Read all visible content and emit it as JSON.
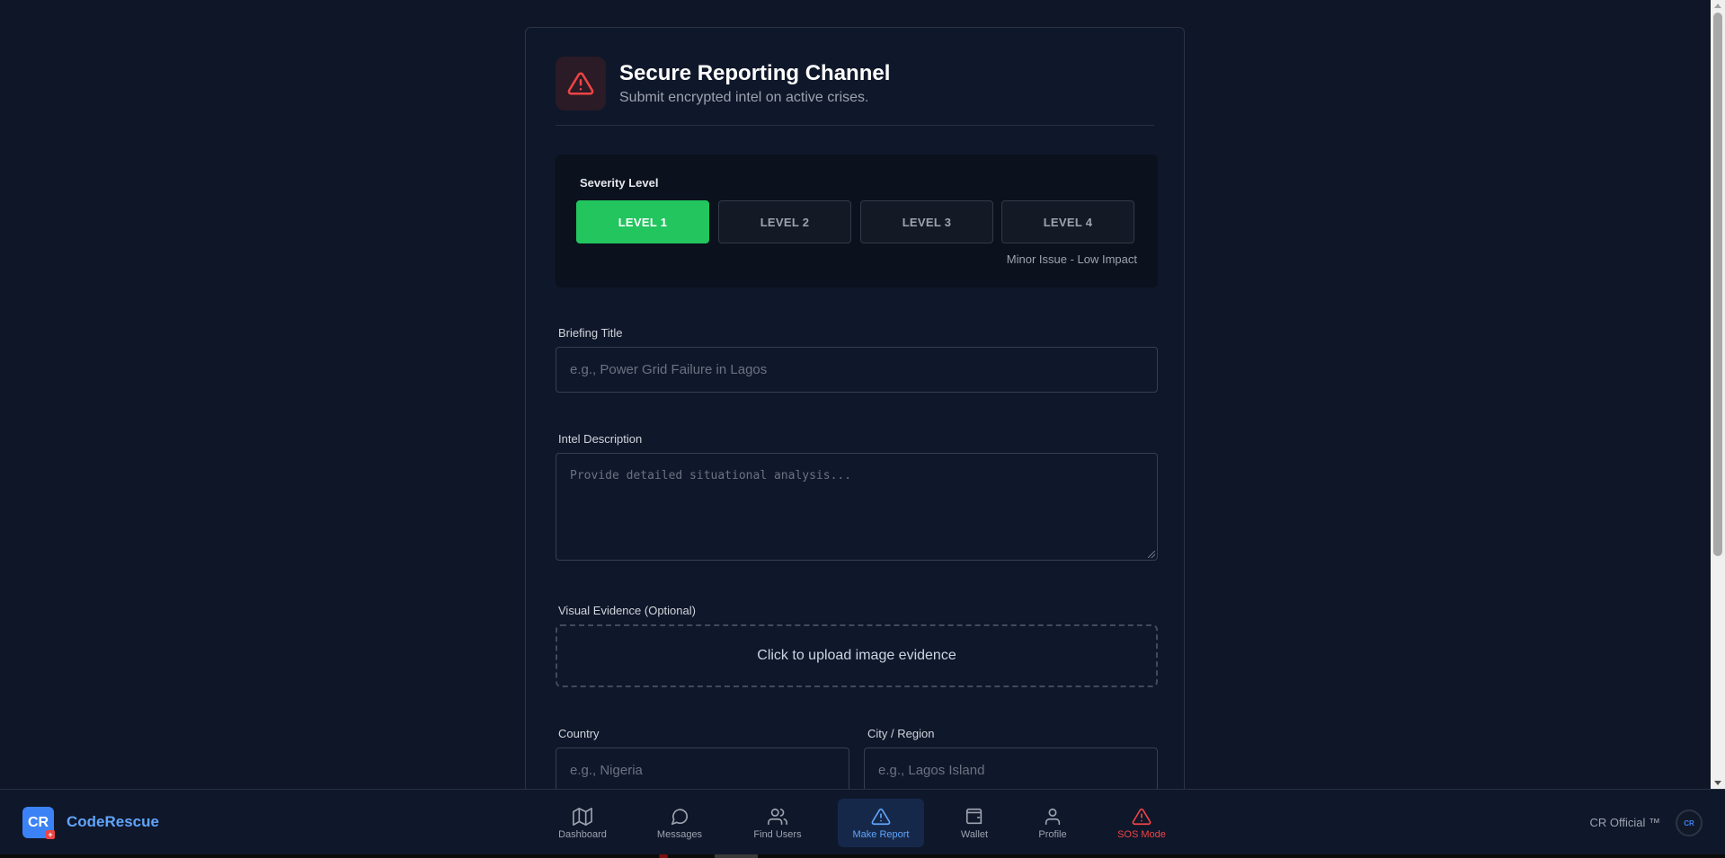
{
  "header": {
    "title": "Secure Reporting Channel",
    "subtitle": "Submit encrypted intel on active crises.",
    "icon": "warning-triangle-icon"
  },
  "severity": {
    "label": "Severity Level",
    "levels": [
      "LEVEL 1",
      "LEVEL 2",
      "LEVEL 3",
      "LEVEL 4"
    ],
    "selected": "LEVEL 1",
    "description": "Minor Issue - Low Impact",
    "active_color": "#22c55e"
  },
  "form": {
    "briefing_title": {
      "label": "Briefing Title",
      "placeholder": "e.g., Power Grid Failure in Lagos"
    },
    "intel_description": {
      "label": "Intel Description",
      "placeholder": "Provide detailed situational analysis..."
    },
    "visual_evidence": {
      "label": "Visual Evidence (Optional)",
      "upload_text": "Click to upload image evidence"
    },
    "country": {
      "label": "Country",
      "placeholder": "e.g., Nigeria"
    },
    "city": {
      "label": "City / Region",
      "placeholder": "e.g., Lagos Island"
    }
  },
  "nav": {
    "brand": "CodeRescue",
    "logo_text": "CR",
    "items": [
      {
        "label": "Dashboard",
        "icon": "map-icon"
      },
      {
        "label": "Messages",
        "icon": "chat-bubble-icon"
      },
      {
        "label": "Find Users",
        "icon": "users-icon"
      },
      {
        "label": "Make Report",
        "icon": "warning-triangle-icon"
      },
      {
        "label": "Wallet",
        "icon": "wallet-icon"
      },
      {
        "label": "Profile",
        "icon": "user-icon"
      },
      {
        "label": "SOS Mode",
        "icon": "alert-triangle-icon"
      }
    ],
    "active": "Make Report",
    "official_text": "CR Official ™",
    "avatar_text": "CR"
  },
  "colors": {
    "background": "#0e1628",
    "accent": "#3b82f6",
    "danger": "#ef4444",
    "success": "#22c55e"
  }
}
